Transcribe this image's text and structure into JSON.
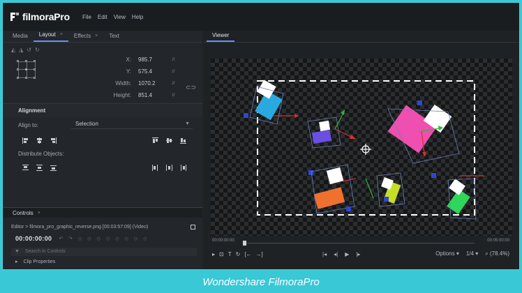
{
  "app": {
    "name": "filmoraPro"
  },
  "menu": [
    "File",
    "Edit",
    "View",
    "Help"
  ],
  "left_tabs": [
    {
      "label": "Media",
      "active": false,
      "closable": false
    },
    {
      "label": "Layout",
      "active": true,
      "closable": true
    },
    {
      "label": "Effects",
      "active": false,
      "closable": true
    },
    {
      "label": "Text",
      "active": false,
      "closable": false
    }
  ],
  "layout": {
    "x_label": "X:",
    "x_value": "985.7",
    "y_label": "Y:",
    "y_value": "575.4",
    "width_label": "Width:",
    "width_value": "1070.2",
    "height_label": "Height:",
    "height_value": "851.4"
  },
  "alignment": {
    "title": "Alignment",
    "align_to_label": "Align to:",
    "align_to_value": "Selection",
    "distribute_label": "Distribute Objects:"
  },
  "controls": {
    "title": "Controls",
    "path": "Editor > filmora_pro_graphic_reverse.png [00:03:57:09] (Video)",
    "timecode": "00:00:00:00",
    "search_placeholder": "Search in Controls",
    "clip_properties": "Clip Properties"
  },
  "viewer": {
    "tab_label": "Viewer",
    "time_start": "00:00:00:00",
    "time_end": "00:05:00:00",
    "options_label": "Options",
    "resolution": "1/4",
    "zoom": "(78.4%)",
    "playhead": 0.0
  },
  "caption": "Wondershare FilmoraPro",
  "colors": {
    "accent": "#6a8cff",
    "frame": "#38c8d6",
    "shape_blue": "#29a9e0",
    "shape_purple": "#6a4fe0",
    "shape_pink": "#ef4fb0",
    "shape_orange": "#f07030",
    "shape_lime": "#c6df24",
    "shape_green": "#2fd659"
  }
}
